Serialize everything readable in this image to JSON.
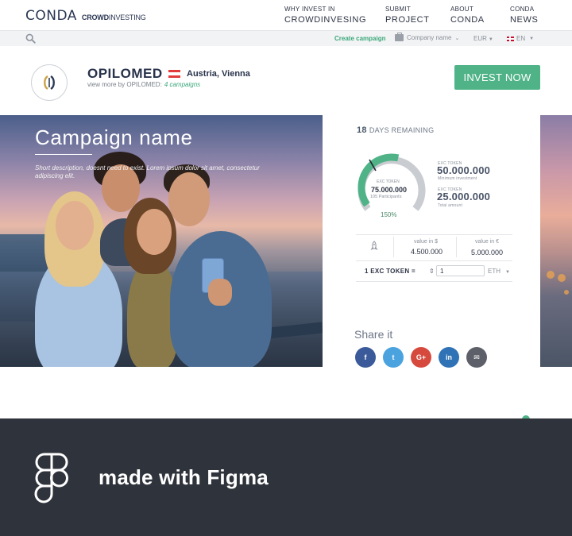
{
  "nav": {
    "logo_main": "CONDA",
    "logo_sub_bold": "CROWD",
    "logo_sub_thin": "INVESTING",
    "links": [
      {
        "l1": "WHY INVEST IN",
        "l2": "CROWDINVESING"
      },
      {
        "l1": "SUBMIT",
        "l2": "PROJECT"
      },
      {
        "l1": "ABOUT",
        "l2": "CONDA"
      },
      {
        "l1": "CONDA",
        "l2": "NEWS"
      }
    ]
  },
  "subbar": {
    "create_campaign": "Create campaign",
    "company_name": "Company name",
    "currency": "EUR",
    "language": "EN"
  },
  "company": {
    "name": "OPILOMED",
    "location": "Austria, Vienna",
    "viewmore": "view more by OPILOMED:",
    "campaigns": "4 campaigns",
    "invest_label": "INVEST NOW"
  },
  "hero": {
    "title": "Campaign name",
    "description": "Short description, doesnt need to exist. Lorem ipsum dolor sit amet, consectetur adipiscing elit."
  },
  "campaign": {
    "days_count": "18",
    "days_label": "DAYS REMAINING",
    "gauge_label": "EXC TOKEN",
    "gauge_value": "75.000.000",
    "participants": "105 Participants",
    "percent": "150%",
    "progress_fraction": 1.5,
    "min_small": "EXC TOKEN",
    "min_value": "50.000.000",
    "min_label": "Minimum investment",
    "total_small": "EXC TOKEN",
    "total_value": "25.000.000",
    "total_label": "Total amount",
    "usd_label": "value in $",
    "usd_value": "4.500.000",
    "eur_label": "value in €",
    "eur_value": "5.000.000",
    "token_label": "1 EXC TOKEN =",
    "token_input": "1",
    "token_unit": "ETH"
  },
  "share": {
    "title": "Share it",
    "buttons": [
      {
        "name": "facebook",
        "glyph": "f",
        "color": "#3b5a9a"
      },
      {
        "name": "twitter",
        "glyph": "t",
        "color": "#4aa3df"
      },
      {
        "name": "google-plus",
        "glyph": "G+",
        "color": "#d64a3e"
      },
      {
        "name": "linkedin",
        "glyph": "in",
        "color": "#2f72b5"
      },
      {
        "name": "email",
        "glyph": "✉",
        "color": "#5d6068"
      }
    ]
  },
  "footer": {
    "text": "made with Figma"
  },
  "colors": {
    "accent": "#4fb387",
    "dark": "#2f333b",
    "text": "#2e3445"
  }
}
